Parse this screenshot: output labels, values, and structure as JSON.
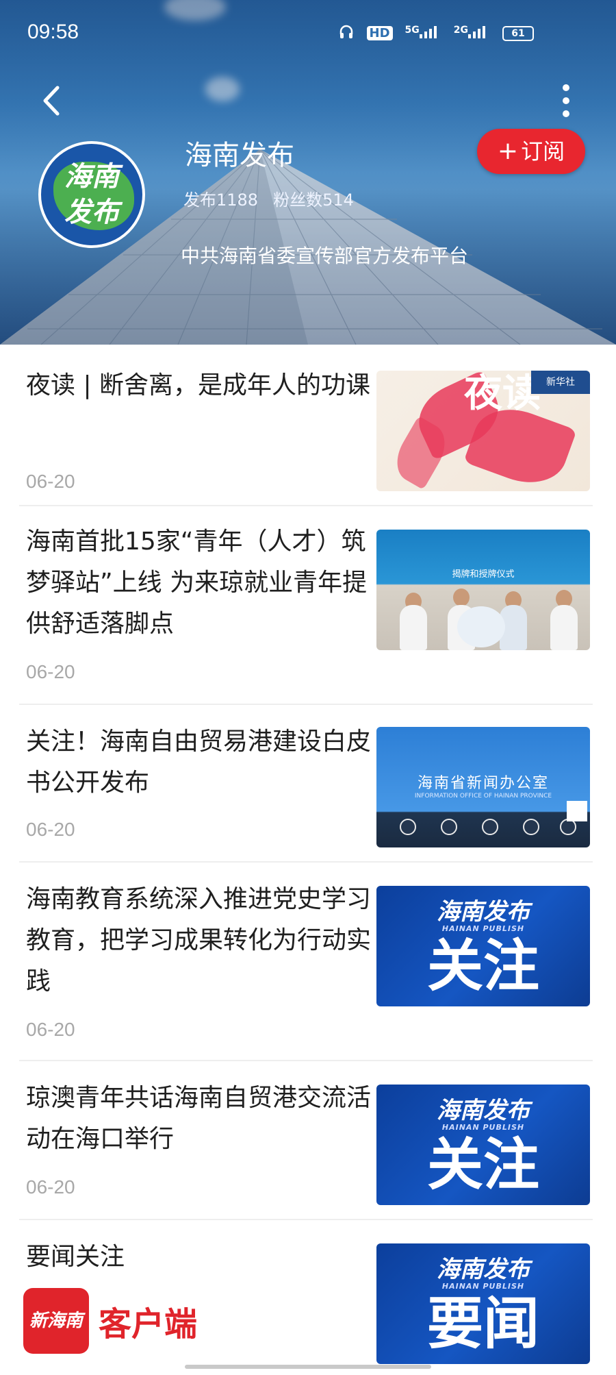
{
  "status_bar": {
    "time": "09:58",
    "icons": [
      "headphones-icon",
      "hd-icon",
      "5g-signal-icon",
      "2g-signal-icon"
    ],
    "network_5g": "5G",
    "network_2g": "2G",
    "hd": "HD",
    "battery": "61"
  },
  "header": {
    "account_name": "海南发布",
    "posts": "发布1188",
    "followers": "粉丝数514",
    "description": "中共海南省委宣传部官方发布平台",
    "subscribe_label": "订阅",
    "avatar_text": "海南发布"
  },
  "articles": [
    {
      "title": "夜读 | 断舍离，是成年人的功课",
      "date": "06-20",
      "thumb_text": "夜读",
      "thumb_tag": "新华社"
    },
    {
      "title": "海南首批15家“青年（人才）筑梦驿站”上线 为来琼就业青年提供舒适落脚点",
      "date": "06-20",
      "thumb_text": "揭牌和授牌仪式"
    },
    {
      "title": "关注！海南自由贸易港建设白皮书公开发布",
      "date": "06-20",
      "thumb_text": "海南省新闻办公室",
      "thumb_subtext": "INFORMATION OFFICE OF HAINAN PROVINCE"
    },
    {
      "title": "海南教育系统深入推进党史学习教育，把学习成果转化为行动实践",
      "date": "06-20",
      "thumb_brand": "海南发布",
      "thumb_brand_en": "HAINAN PUBLISH",
      "thumb_text": "关注"
    },
    {
      "title": "琼澳青年共话海南自贸港交流活动在海口举行",
      "date": "06-20",
      "thumb_brand": "海南发布",
      "thumb_brand_en": "HAINAN PUBLISH",
      "thumb_text": "关注"
    },
    {
      "title": "要闻关注",
      "thumb_brand": "海南发布",
      "thumb_brand_en": "HAINAN PUBLISH",
      "thumb_text": "要闻"
    }
  ],
  "watermark": {
    "logo": "新海南",
    "text": "客户端"
  },
  "colors": {
    "accent_red": "#e8262f",
    "brand_blue": "#1556c2",
    "date_gray": "#a8a8a8"
  }
}
